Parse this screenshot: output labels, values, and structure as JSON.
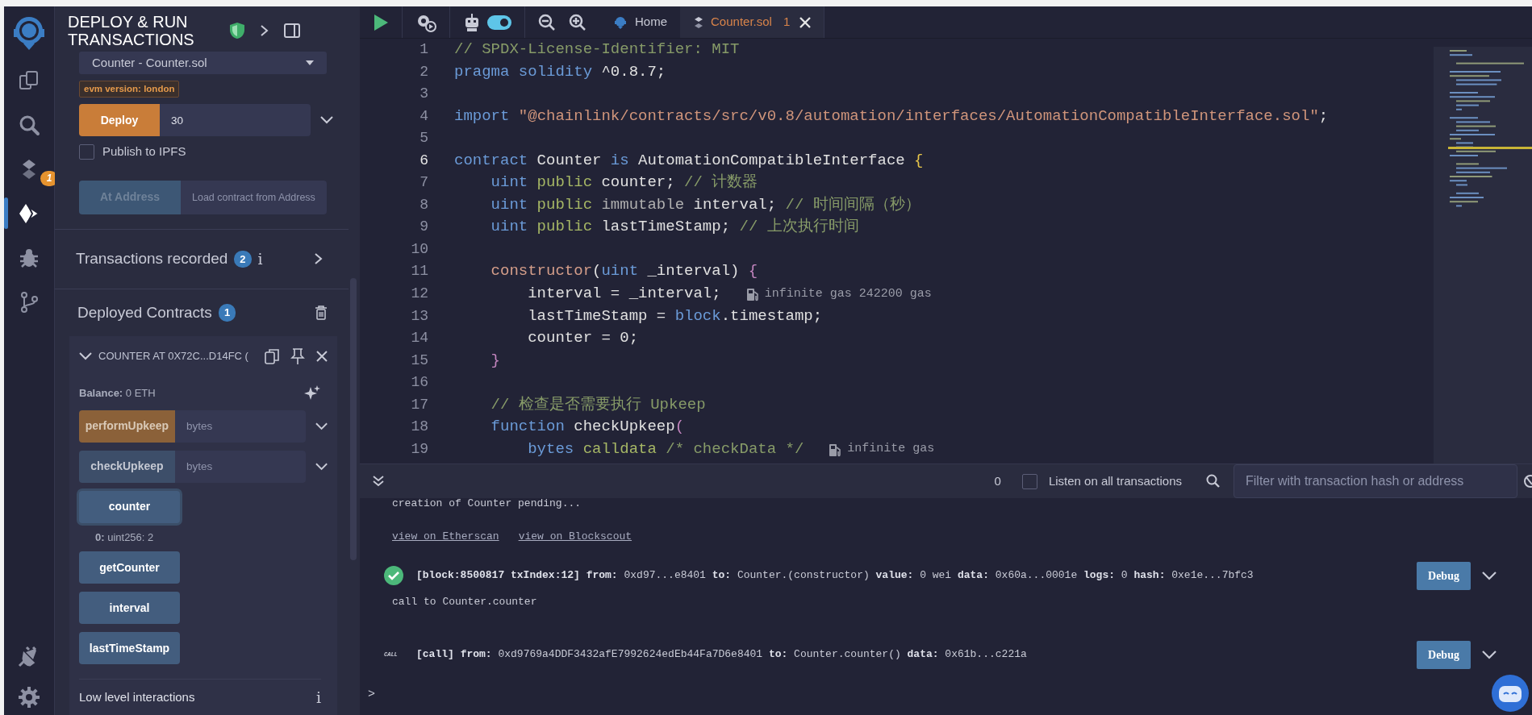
{
  "icon_bar": {
    "items": [
      {
        "selected": false
      },
      {
        "selected": false
      },
      {
        "selected": false,
        "badge": "1"
      },
      {
        "selected": true
      },
      {
        "selected": false
      },
      {
        "selected": false
      }
    ]
  },
  "side_panel": {
    "title": "DEPLOY & RUN TRANSACTIONS",
    "contract_select": "Counter - Counter.sol",
    "evm_badge": "evm version: london",
    "deploy": {
      "label": "Deploy",
      "value": "30"
    },
    "publish": {
      "label": "Publish to IPFS",
      "checked": false
    },
    "at_address": {
      "label": "At Address",
      "placeholder": "Load contract from Address",
      "disabled": true
    },
    "transactions_recorded": {
      "label": "Transactions recorded",
      "count": "2",
      "info": "i"
    },
    "deployed_contracts": {
      "label": "Deployed Contracts",
      "count": "1",
      "instance": {
        "title": "COUNTER AT 0X72C...D14FC (",
        "expanded": true,
        "balance": "**Balance:** 0 ETH",
        "functions": [
          {
            "label": "performUpkeep",
            "kind": "transact",
            "placeholder": "bytes",
            "focused": false
          },
          {
            "label": "checkUpkeep",
            "kind": "call",
            "placeholder": "bytes",
            "focused": false
          },
          {
            "label": "counter",
            "kind": "call",
            "focused": true,
            "result": "**0:** uint256: 2"
          },
          {
            "label": "getCounter",
            "kind": "call",
            "focused": false
          },
          {
            "label": "interval",
            "kind": "call",
            "focused": false
          },
          {
            "label": "lastTimeStamp",
            "kind": "call",
            "focused": false
          }
        ]
      }
    },
    "low_level": {
      "label": "Low level interactions",
      "info": "i"
    }
  },
  "editor": {
    "toolbar": {
      "auto_compile": {
        "on": true
      }
    },
    "tabs": [
      {
        "label": "Home",
        "selected": false
      },
      {
        "label": "Counter.sol",
        "selected": true,
        "badge": "1"
      }
    ],
    "lines": [
      {
        "n": "1",
        "current": false,
        "tokens": [
          {
            "kind": "comment",
            "text": "// SPDX-License-Identifier: MIT"
          }
        ]
      },
      {
        "n": "2",
        "current": false,
        "tokens": [
          {
            "kind": "keyword",
            "text": "pragma"
          },
          {
            "kind": "keyword",
            "text": " solidity"
          },
          {
            "kind": "plain",
            "text": " ^0.8.7;"
          }
        ]
      },
      {
        "n": "3",
        "current": false
      },
      {
        "n": "4",
        "current": false,
        "tokens": [
          {
            "kind": "keyword",
            "text": "import"
          },
          {
            "kind": "string",
            "text": " \"@chainlink/contracts/src/v0.8/automation/interfaces/AutomationCompatibleInterface.sol\""
          },
          {
            "kind": "plain",
            "text": ";"
          }
        ]
      },
      {
        "n": "5",
        "current": false
      },
      {
        "n": "6",
        "current": true,
        "tokens": [
          {
            "kind": "keyword",
            "text": "contract"
          },
          {
            "kind": "plain",
            "text": " Counter"
          },
          {
            "kind": "keyword",
            "text": " is"
          },
          {
            "kind": "plain",
            "text": " AutomationCompatibleInterface"
          },
          {
            "kind": "brace",
            "text": " {"
          }
        ]
      },
      {
        "n": "7",
        "current": false,
        "tokens": [
          {
            "kind": "keyword",
            "text": "    uint"
          },
          {
            "kind": "modifier",
            "text": " public"
          },
          {
            "kind": "plain",
            "text": " counter;"
          },
          {
            "kind": "comment",
            "text": " // 计数器"
          }
        ]
      },
      {
        "n": "8",
        "current": false,
        "tokens": [
          {
            "kind": "keyword",
            "text": "    uint"
          },
          {
            "kind": "modifier",
            "text": " public"
          },
          {
            "kind": "dim",
            "text": " immutable"
          },
          {
            "kind": "plain",
            "text": " interval;"
          },
          {
            "kind": "comment",
            "text": " // 时间间隔（秒）"
          }
        ]
      },
      {
        "n": "9",
        "current": false,
        "tokens": [
          {
            "kind": "keyword",
            "text": "    uint"
          },
          {
            "kind": "modifier",
            "text": " public"
          },
          {
            "kind": "plain",
            "text": " lastTimeStamp;"
          },
          {
            "kind": "comment",
            "text": " // 上次执行时间"
          }
        ]
      },
      {
        "n": "10",
        "current": false
      },
      {
        "n": "11",
        "current": false,
        "tokens": [
          {
            "kind": "function",
            "text": "    constructor"
          },
          {
            "kind": "plain",
            "text": "("
          },
          {
            "kind": "keyword",
            "text": "uint"
          },
          {
            "kind": "plain",
            "text": " _interval)"
          },
          {
            "kind": "bracket",
            "text": " {"
          }
        ]
      },
      {
        "n": "12",
        "current": false,
        "tokens": [
          {
            "kind": "plain",
            "text": "        interval = _interval;"
          }
        ],
        "gas_hint": "infinite gas 242200 gas"
      },
      {
        "n": "13",
        "current": false,
        "tokens": [
          {
            "kind": "plain",
            "text": "        lastTimeStamp = "
          },
          {
            "kind": "keyword",
            "text": "block"
          },
          {
            "kind": "plain",
            "text": ".timestamp;"
          }
        ]
      },
      {
        "n": "14",
        "current": false,
        "tokens": [
          {
            "kind": "plain",
            "text": "        counter = 0;"
          }
        ]
      },
      {
        "n": "15",
        "current": false,
        "tokens": [
          {
            "kind": "bracket",
            "text": "    }"
          }
        ]
      },
      {
        "n": "16",
        "current": false
      },
      {
        "n": "17",
        "current": false,
        "tokens": [
          {
            "kind": "comment",
            "text": "    // 检查是否需要执行 Upkeep"
          }
        ]
      },
      {
        "n": "18",
        "current": false,
        "tokens": [
          {
            "kind": "keyword",
            "text": "    function"
          },
          {
            "kind": "plain",
            "text": " checkUpkeep"
          },
          {
            "kind": "bracket",
            "text": "("
          }
        ]
      },
      {
        "n": "19",
        "current": false,
        "tokens": [
          {
            "kind": "keyword",
            "text": "        bytes"
          },
          {
            "kind": "modifier",
            "text": " calldata"
          },
          {
            "kind": "comment",
            "text": " /* checkData */"
          }
        ],
        "gas_hint": "infinite gas"
      }
    ]
  },
  "terminal": {
    "toolbar": {
      "pending_count": "0",
      "listen": {
        "label": "Listen on all transactions",
        "checked": false
      },
      "filter_placeholder": "Filter with transaction hash or address"
    },
    "log": [
      {
        "kind": "text",
        "text": "creation of Counter pending..."
      },
      {
        "kind": "links",
        "links": [
          "view on Etherscan",
          "view on Blockscout"
        ]
      },
      {
        "kind": "tx",
        "text": "**[block:8500817 txIndex:12]** **from:** 0xd97...e8401 **to:** Counter.(constructor) **value:** 0 wei **data:** 0x60a...0001e **logs:** 0 **hash:** 0xe1e...7bfc3",
        "button": "Debug"
      },
      {
        "kind": "text",
        "text": "call to Counter.counter"
      },
      {
        "kind": "call",
        "tag": "CALL",
        "text": "**[call]** **from:** 0xd9769a4DDF3432afE7992624edEb44Fa7D6e8401 **to:** Counter.counter() **data:** 0x61b...c221a",
        "button": "Debug"
      }
    ],
    "prompt": ">"
  }
}
